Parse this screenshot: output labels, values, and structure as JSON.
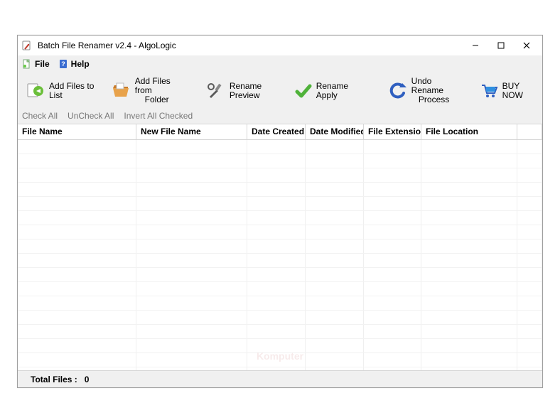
{
  "title": "Batch File Renamer v2.4 - AlgoLogic",
  "menu": {
    "file": "File",
    "help": "Help"
  },
  "toolbar": {
    "add_files": "Add Files to List",
    "add_folder_l1": "Add Files from",
    "add_folder_l2": "Folder",
    "rename_preview": "Rename Preview",
    "rename_apply": "Rename Apply",
    "undo_l1": "Undo Rename",
    "undo_l2": "Process",
    "buy_now": "BUY NOW"
  },
  "subbar": {
    "check_all": "Check All",
    "uncheck_all": "UnCheck All",
    "invert": "Invert All Checked"
  },
  "columns": {
    "file_name": "File Name",
    "new_file_name": "New File Name",
    "date_created": "Date Created",
    "date_modified": "Date Modified",
    "file_ext": "File Extension",
    "file_loc": "File Location"
  },
  "rows": [],
  "status": {
    "label": "Total Files :",
    "value": "0"
  },
  "watermark": "Komputer"
}
